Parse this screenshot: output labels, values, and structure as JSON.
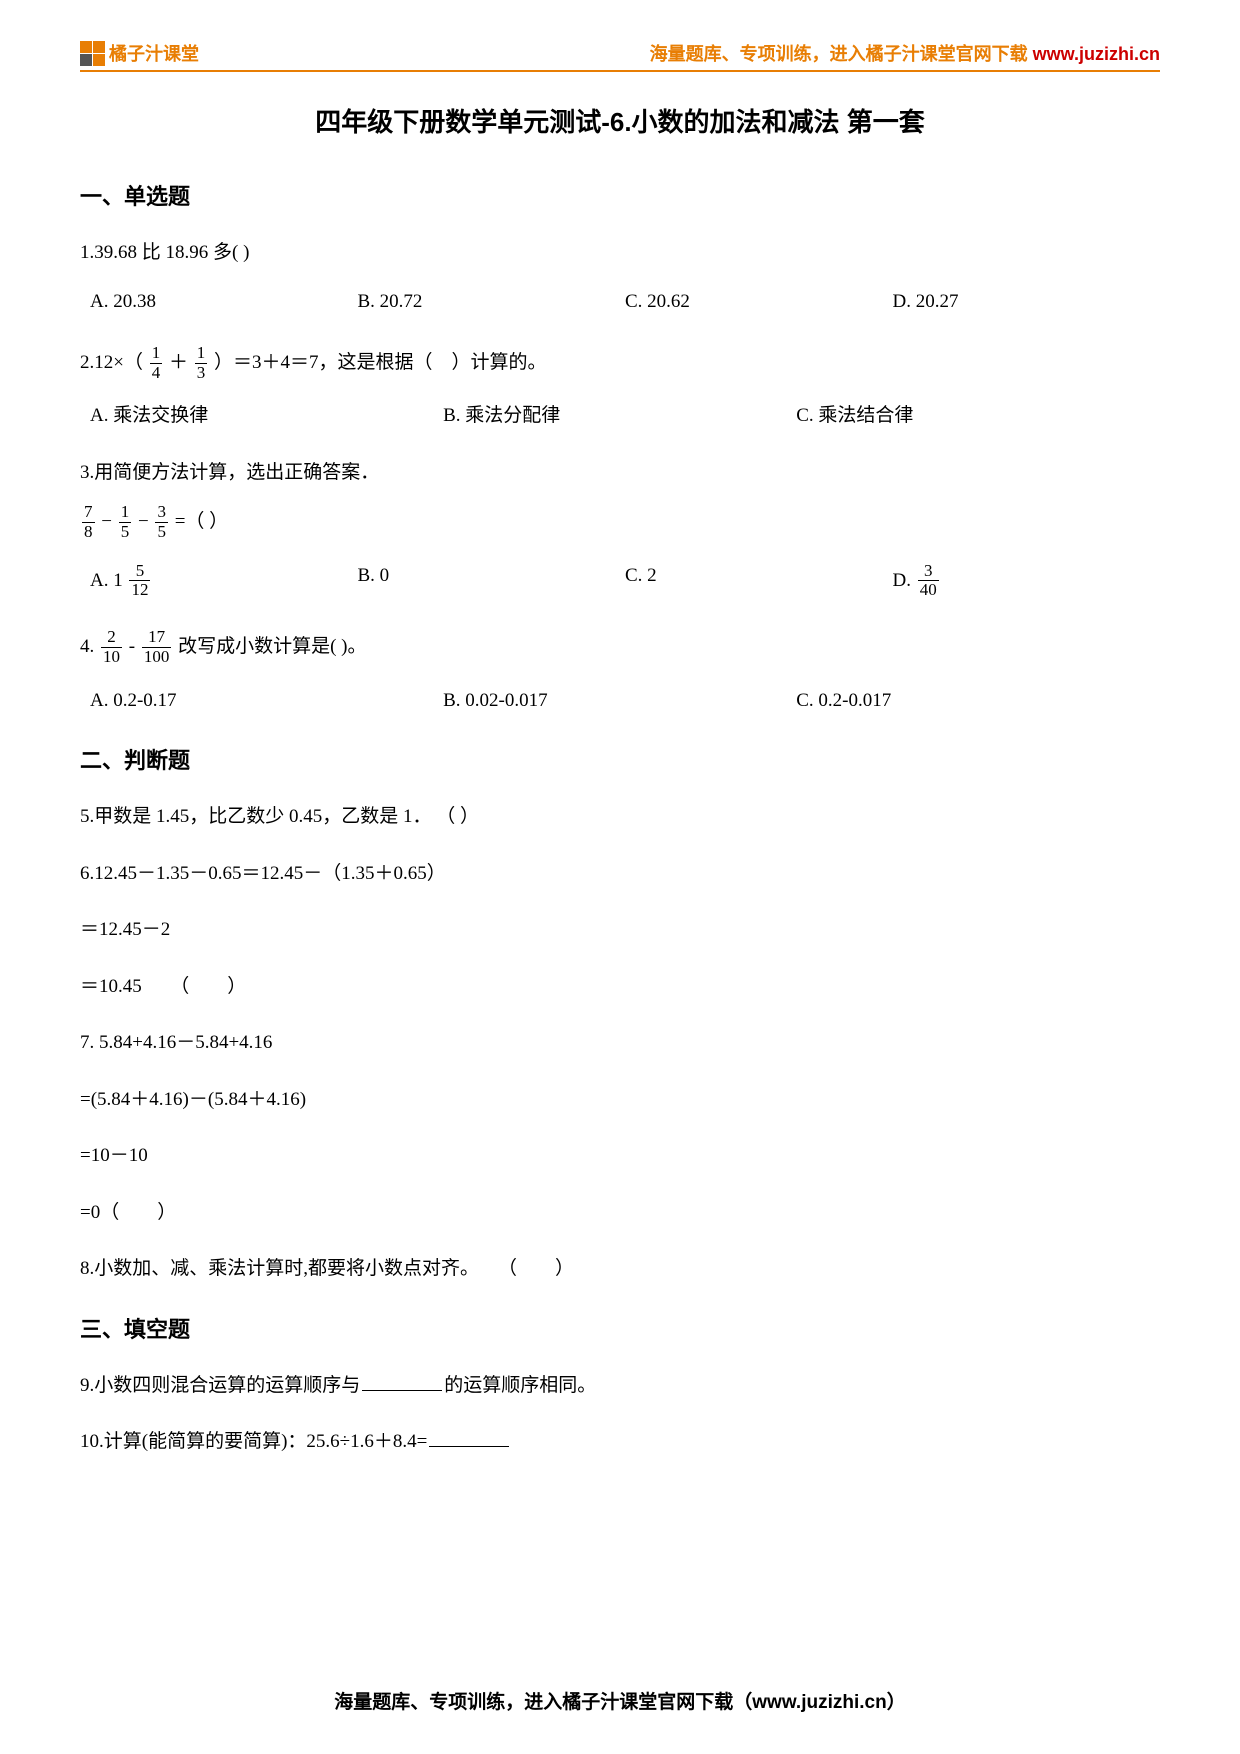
{
  "header": {
    "brand": "橘子汁课堂",
    "tagline_prefix": "海量题库、专项训练，进入橘子汁课堂官网下载 ",
    "url": "www.juzizhi.cn"
  },
  "title": "四年级下册数学单元测试-6.小数的加法和减法 第一套",
  "sections": {
    "mc": "一、单选题",
    "tf": "二、判断题",
    "fb": "三、填空题"
  },
  "q1": {
    "text": "1.39.68 比 18.96 多(   )",
    "a": "A. 20.38",
    "b": "B. 20.72",
    "c": "C. 20.62",
    "d": "D. 20.27"
  },
  "q2": {
    "prefix": "2.12×（",
    "plus": " ＋ ",
    "suffix": "）＝3＋4＝7，这是根据（　）计算的。",
    "f1n": "1",
    "f1d": "4",
    "f2n": "1",
    "f2d": "3",
    "a": "A. 乘法交换律",
    "b": "B. 乘法分配律",
    "c": "C. 乘法结合律"
  },
  "q3": {
    "text": "3.用简便方法计算，选出正确答案．",
    "f1n": "7",
    "f1d": "8",
    "f2n": "1",
    "f2d": "5",
    "f3n": "3",
    "f3d": "5",
    "eq": " =（  ）",
    "a_pre": "A. 1 ",
    "a_n": "5",
    "a_d": "12",
    "b": "B. 0",
    "c": "C. 2",
    "d_pre": "D. ",
    "d_n": "3",
    "d_d": "40"
  },
  "q4": {
    "prefix": "4.",
    "f1n": "2",
    "f1d": "10",
    "mid": " - ",
    "f2n": "17",
    "f2d": "100",
    "suffix": " 改写成小数计算是(   )。",
    "a": "A. 0.2-0.17",
    "b": "B. 0.02-0.017",
    "c": "C. 0.2-0.017"
  },
  "q5": "5.甲数是 1.45，比乙数少 0.45，乙数是 1． （   ）",
  "q6": {
    "l1": "6.12.45－1.35－0.65＝12.45－（1.35＋0.65）",
    "l2": "＝12.45－2",
    "l3": "＝10.45　　（　　）"
  },
  "q7": {
    "l1": "7. 5.84+4.16－5.84+4.16",
    "l2": "=(5.84＋4.16)－(5.84＋4.16)",
    "l3": "=10－10",
    "l4": "=0（　　）"
  },
  "q8": "8.小数加、减、乘法计算时,都要将小数点对齐。　　（　　）",
  "q9": {
    "pre": "9.小数四则混合运算的运算顺序与",
    "post": "的运算顺序相同。"
  },
  "q10": {
    "pre": "10.计算(能简算的要简算)：25.6÷1.6＋8.4="
  },
  "footer": "海量题库、专项训练，进入橘子汁课堂官网下载（www.juzizhi.cn）"
}
